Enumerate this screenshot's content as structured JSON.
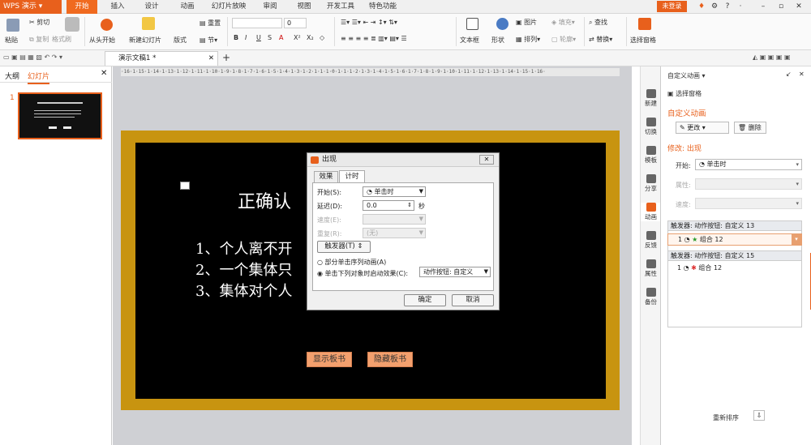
{
  "app": {
    "name": "WPS 演示",
    "login": "未登录"
  },
  "menu": [
    "开始",
    "插入",
    "设计",
    "动画",
    "幻灯片放映",
    "审阅",
    "视图",
    "开发工具",
    "特色功能"
  ],
  "ribbon": {
    "paste": "粘贴",
    "cut": "剪切",
    "copy": "复制",
    "format_painter": "格式刷",
    "play_from_start": "从头开始",
    "new_slide": "新建幻灯片",
    "layout": "版式",
    "section": "节",
    "reset": "重置",
    "font_size": "0",
    "textbox": "文本框",
    "shape": "形状",
    "picture": "图片",
    "fill": "填充",
    "arrange": "排列",
    "outline": "轮廓",
    "find": "查找",
    "replace": "替换",
    "selection_pane": "选择窗格"
  },
  "doc_tab": {
    "title": "演示文稿1 *"
  },
  "left_pane": {
    "tab_outline": "大纲",
    "tab_slides": "幻灯片",
    "slide_num": "1"
  },
  "ruler": "·16·1·15·1·14·1·13·1·12·1·11·1·10·1·9·1·8·1·7·1·6·1·5·1·4·1·3·1·2·1·1·1·0·1·1·1·2·1·3·1·4·1·5·1·6·1·7·1·8·1·9·1·10·1·11·1·12·1·13·1·14·1·15·1·16·",
  "slide": {
    "title": "正确认",
    "line1": "1、个人离不开",
    "line2": "2、一个集体只",
    "line3": "3、集体对个人",
    "btn_show": "显示板书",
    "btn_hide": "隐藏板书"
  },
  "dialog": {
    "title": "出现",
    "tab_effect": "效果",
    "tab_timing": "计时",
    "start_label": "开始(S):",
    "start_value": "单击时",
    "delay_label": "延迟(D):",
    "delay_value": "0.0",
    "delay_unit": "秒",
    "speed_label": "速度(E):",
    "repeat_label": "重复(R):",
    "repeat_value": "(无)",
    "trigger_btn": "触发器(T) ⇕",
    "radio1": "部分单击序列动画(A)",
    "radio2": "单击下列对象时启动效果(C):",
    "radio2_value": "动作按钮: 自定义",
    "ok": "确定",
    "cancel": "取消"
  },
  "side_strip": [
    "新建",
    "切换",
    "模板",
    "分享",
    "动画",
    "反馈",
    "属性",
    "备份"
  ],
  "right_pane": {
    "header": "自定义动画",
    "selection_pane": "选择窗格",
    "section_title": "自定义动画",
    "change_btn": "更改",
    "delete_btn": "删除",
    "modify_label": "修改: 出现",
    "start_label": "开始:",
    "start_value": "单击时",
    "property_label": "属性:",
    "speed_label": "速度:",
    "trigger1": "触发器: 动作按钮: 自定义 13",
    "item1_num": "1",
    "item1_name": "组合 12",
    "trigger2": "触发器: 动作按钮: 自定义 15",
    "item2_num": "1",
    "item2_name": "组合 12",
    "reorder": "重新排序"
  },
  "colors": {
    "accent": "#e8601c",
    "board": "#000000",
    "frame": "#c89410",
    "slide_button": "#f3a06e"
  }
}
